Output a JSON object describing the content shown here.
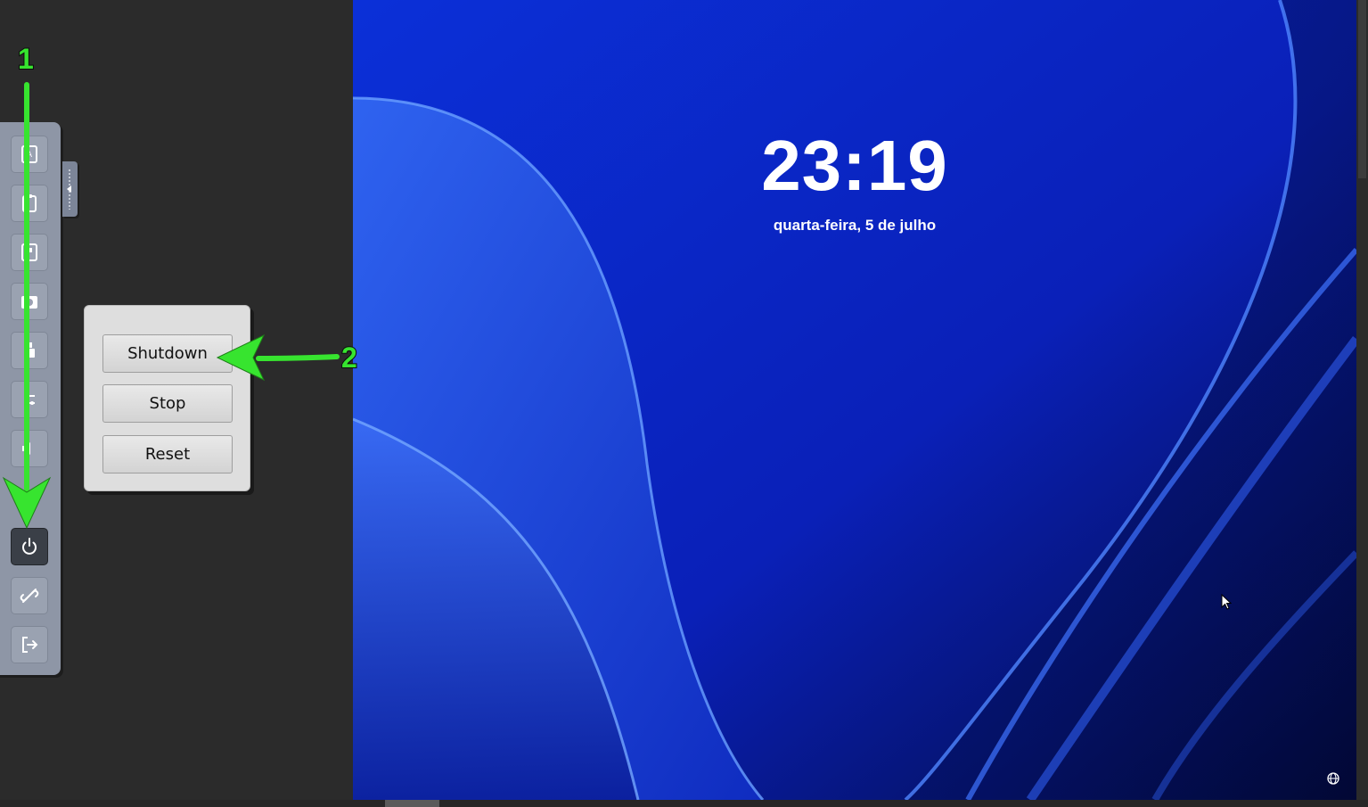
{
  "sidebar": {
    "buttons": [
      {
        "icon": "keyboard-icon"
      },
      {
        "icon": "clipboard-icon"
      },
      {
        "icon": "screenshot-icon"
      },
      {
        "icon": "camera-icon"
      },
      {
        "icon": "usb-icon"
      },
      {
        "icon": "settings-icon"
      },
      {
        "icon": "audio-icon"
      },
      {
        "icon": "power-icon",
        "active": true
      },
      {
        "icon": "disconnect-icon"
      },
      {
        "icon": "logout-icon"
      }
    ]
  },
  "power_menu": {
    "shutdown_label": "Shutdown",
    "stop_label": "Stop",
    "reset_label": "Reset"
  },
  "lock_screen": {
    "time": "23:19",
    "date": "quarta-feira, 5 de julho"
  },
  "annotations": {
    "step1": "1",
    "step2": "2",
    "color": "#37e42f"
  },
  "colors": {
    "wallpaper_base": "#0a2ad0",
    "sidebar_bg": "#8e96a6",
    "page_bg": "#2b2b2b"
  }
}
